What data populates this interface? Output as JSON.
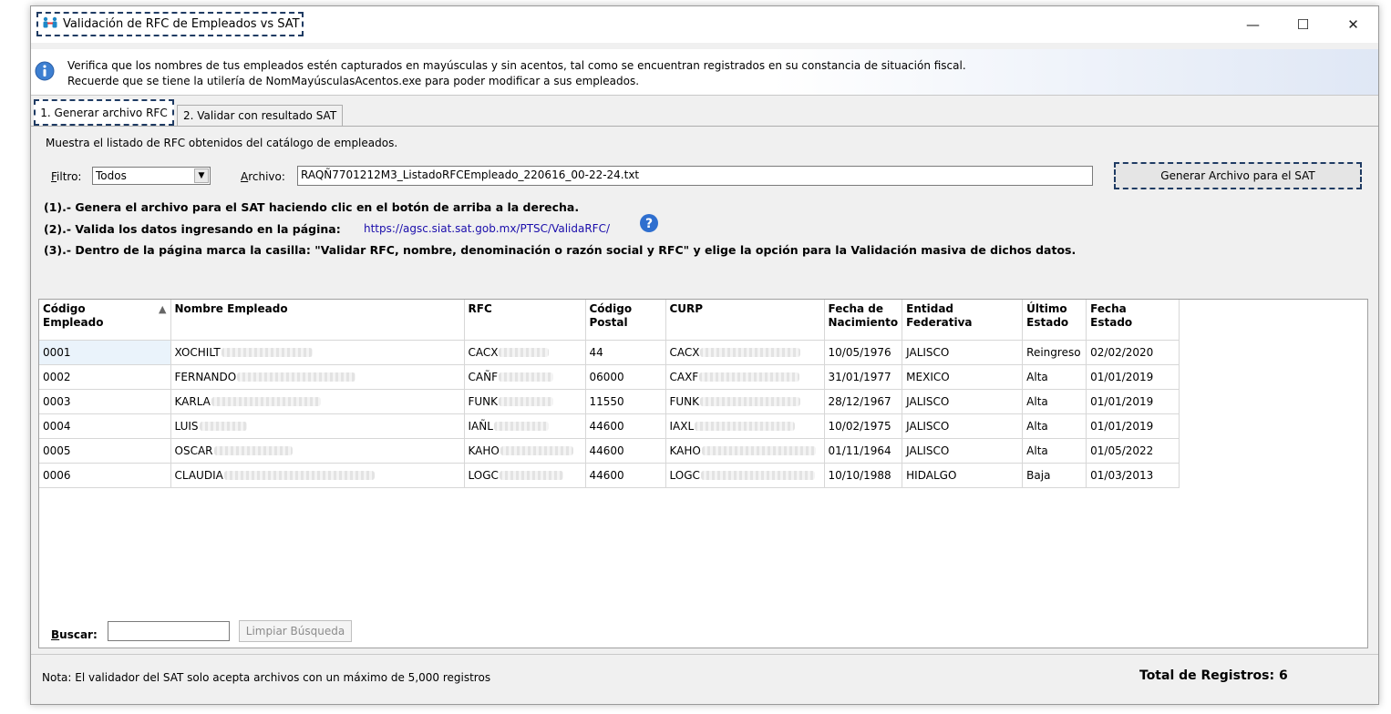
{
  "window": {
    "title": "Validación de RFC de Empleados vs SAT",
    "controls": {
      "minimize": "—",
      "maximize": "☐",
      "close": "✕"
    }
  },
  "info": {
    "line1": "Verifica que los nombres de tus empleados estén capturados en mayúsculas y sin acentos, tal como se encuentran registrados en su constancia de situación fiscal.",
    "line2": "Recuerde que se tiene la utilería de NomMayúsculasAcentos.exe para poder modificar a sus empleados."
  },
  "tabs": [
    {
      "label": "1. Generar archivo RFC",
      "active": true
    },
    {
      "label": "2. Validar con resultado SAT",
      "active": false
    }
  ],
  "panel": {
    "description": "Muestra el listado de RFC obtenidos del catálogo de empleados.",
    "filtro_label": "Filtro:",
    "filtro_value": "Todos",
    "archivo_label": "Archivo:",
    "archivo_value": "RAQÑ7701212M3_ListadoRFCEmpleado_220616_00-22-24.txt",
    "generate_button": "Generar Archivo para el SAT",
    "step1": "(1).- Genera el archivo para el SAT haciendo clic en el botón de arriba a la derecha.",
    "step2": "(2).- Valida los datos ingresando en la página:",
    "link": "https://agsc.siat.sat.gob.mx/PTSC/ValidaRFC/",
    "step3": "(3).- Dentro de la página marca la casilla: \"Validar RFC, nombre, denominación o razón social y RFC\" y elige la opción para la Validación masiva de dichos datos."
  },
  "table": {
    "columns": [
      {
        "line1": "Código",
        "line2": "Empleado"
      },
      {
        "line1": "Nombre Empleado",
        "line2": ""
      },
      {
        "line1": "RFC",
        "line2": ""
      },
      {
        "line1": "Código",
        "line2": "Postal"
      },
      {
        "line1": "CURP",
        "line2": ""
      },
      {
        "line1": "Fecha de",
        "line2": "Nacimiento"
      },
      {
        "line1": "Entidad",
        "line2": "Federativa"
      },
      {
        "line1": "Último",
        "line2": "Estado"
      },
      {
        "line1": "Fecha",
        "line2": "Estado"
      }
    ],
    "rows": [
      [
        "0001",
        "XOCHILT",
        "CACX",
        "44",
        "CACX",
        "10/05/1976",
        "JALISCO",
        "Reingreso",
        "02/02/2020"
      ],
      [
        "0002",
        "FERNANDO",
        "CAÑF",
        "06000",
        "CAXF",
        "31/01/1977",
        "MEXICO",
        "Alta",
        "01/01/2019"
      ],
      [
        "0003",
        "KARLA",
        "FUNK",
        "11550",
        "FUNK",
        "28/12/1967",
        "JALISCO",
        "Alta",
        "01/01/2019"
      ],
      [
        "0004",
        "LUIS",
        "IAÑL",
        "44600",
        "IAXL",
        "10/02/1975",
        "JALISCO",
        "Alta",
        "01/01/2019"
      ],
      [
        "0005",
        "OSCAR",
        "KAHO",
        "44600",
        "KAHO",
        "01/11/1964",
        "JALISCO",
        "Alta",
        "01/05/2022"
      ],
      [
        "0006",
        "CLAUDIA",
        "LOGC",
        "44600",
        "LOGC",
        "10/10/1988",
        "HIDALGO",
        "Baja",
        "01/03/2013"
      ]
    ]
  },
  "search": {
    "label": "Buscar:",
    "value": "",
    "clear_button": "Limpiar Búsqueda"
  },
  "footer": {
    "note": "Nota: El validador del SAT solo acepta archivos con un máximo de 5,000 registros",
    "total": "Total de Registros: 6"
  }
}
